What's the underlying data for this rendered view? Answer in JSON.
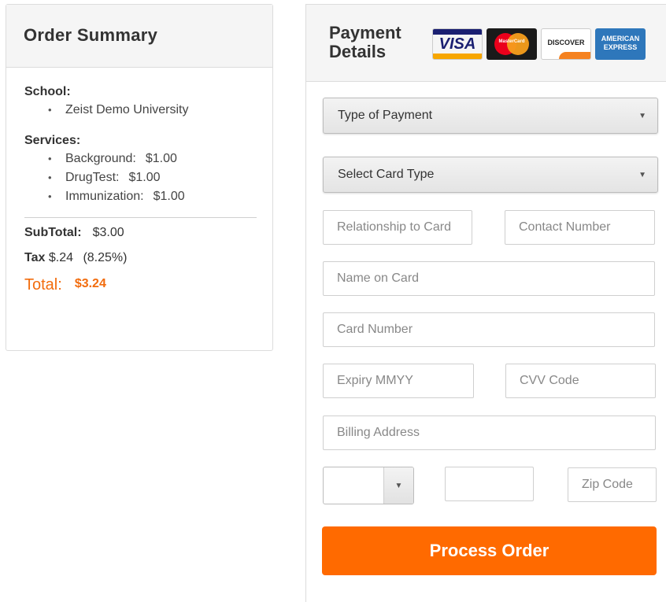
{
  "order_summary": {
    "title": "Order Summary",
    "school_label": "School:",
    "schools": [
      "Zeist Demo University"
    ],
    "services_label": "Services:",
    "services": [
      {
        "name": "Background:",
        "amount": "$1.00"
      },
      {
        "name": "DrugTest:",
        "amount": "$1.00"
      },
      {
        "name": "Immunization:",
        "amount": "$1.00"
      }
    ],
    "subtotal_label": "SubTotal:",
    "subtotal_value": "$3.00",
    "tax_label": "Tax",
    "tax_value": "$.24",
    "tax_rate": "(8.25%)",
    "total_label": "Total:",
    "total_value": "$3.24"
  },
  "payment": {
    "title_line1": "Payment",
    "title_line2": "Details",
    "card_logos": [
      {
        "name": "visa-logo",
        "text": "VISA"
      },
      {
        "name": "mastercard-logo",
        "text": "MasterCard"
      },
      {
        "name": "discover-logo",
        "text": "DISCOVER"
      },
      {
        "name": "amex-logo",
        "text": "AMERICAN EXPRESS"
      }
    ],
    "type_of_payment": "Type of Payment",
    "card_type": "Select Card Type",
    "relationship_placeholder": "Relationship to Card",
    "contact_placeholder": "Contact Number",
    "name_placeholder": "Name on Card",
    "card_number_placeholder": "Card Number",
    "expiry_placeholder": "Expiry MMYY",
    "cvv_placeholder": "CVV Code",
    "billing_placeholder": "Billing Address",
    "state_value": "",
    "city_value": "",
    "zip_placeholder": "Zip Code",
    "process_label": "Process Order"
  },
  "colors": {
    "accent": "#ff6a00",
    "total_text": "#f26c0d",
    "panel_header_bg": "#f5f5f5",
    "border": "#dcdcdc"
  }
}
